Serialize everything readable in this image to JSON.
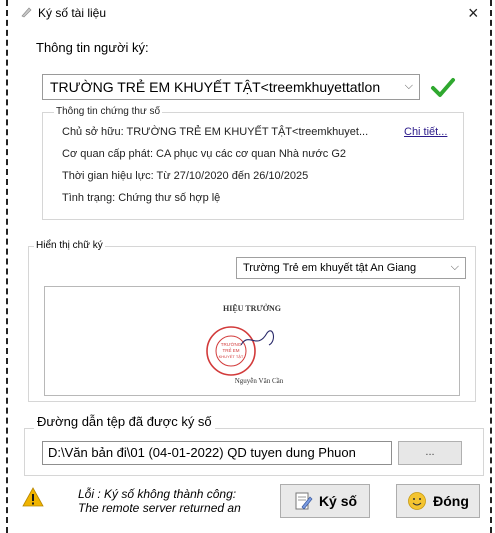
{
  "window": {
    "title": "Ký số tài liệu",
    "close_glyph": "×"
  },
  "signer": {
    "section_label": "Thông tin người ký:",
    "selected": "TRƯỜNG TRẺ EM KHUYẾT TẬT<treemkhuyettatlon",
    "dropdown_glyph": "⌵",
    "verified_icon": "check-icon",
    "verified_color": "#2fa82f"
  },
  "certificate": {
    "legend": "Thông tin chứng thư số",
    "owner": "Chủ sở hữu: TRƯỜNG TRẺ EM KHUYẾT TẬT<treemkhuyet...",
    "detail_link": "Chi tiết...",
    "issuer": "Cơ quan cấp phát: CA phục vụ các cơ quan Nhà nước G2",
    "validity": "Thời gian hiệu lực: Từ 27/10/2020 đến 26/10/2025",
    "status": "Tình trạng: Chứng thư số hợp lệ"
  },
  "signature_display": {
    "legend": "Hiển thị chữ ký",
    "selected": "Trường Trẻ em khuyết tật An Giang",
    "dropdown_glyph": "⌵",
    "preview": {
      "title": "HIỆU TRƯỞNG",
      "stamp_text_1": "TRƯỜNG",
      "stamp_text_2": "TRẺ EM",
      "stamp_text_3": "KHUYẾT TẬT",
      "name": "Nguyễn Văn Cần",
      "stamp_color": "#d23a3a"
    }
  },
  "signed_path": {
    "label": "Đường dẫn tệp đã được ký số",
    "value": "D:\\Văn bản đi\\01 (04-01-2022) QD tuyen dung Phuon",
    "browse_label": "..."
  },
  "error": {
    "line1": "Lỗi : Ký số không thành công:",
    "line2": "The remote server returned an",
    "icon": "warning-icon",
    "icon_color": "#f0b400"
  },
  "buttons": {
    "sign_label": "Ký số",
    "sign_icon": "sign-document-icon",
    "close_label": "Đóng",
    "close_icon": "emoji-close-icon"
  }
}
